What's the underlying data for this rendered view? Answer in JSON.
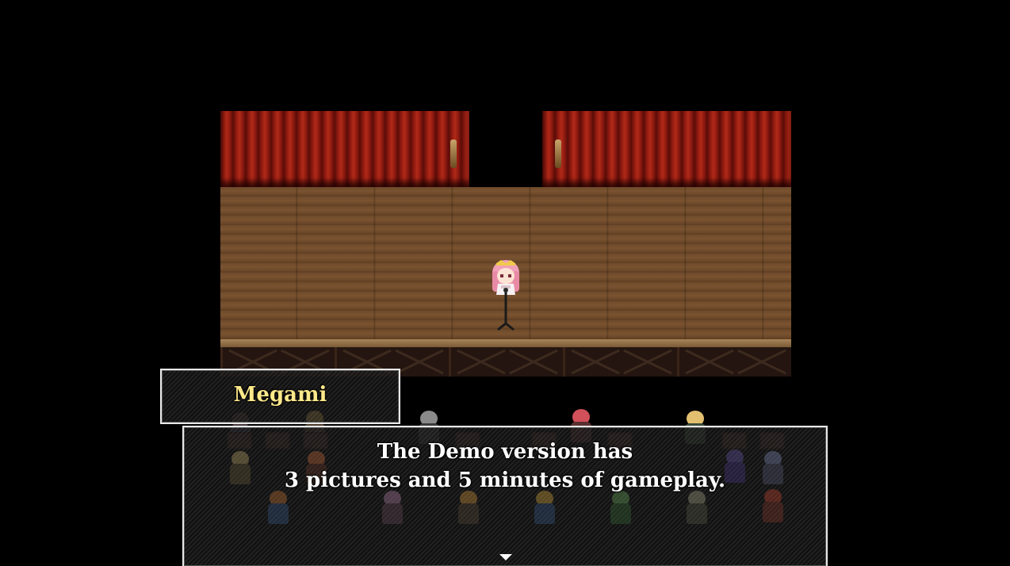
{
  "dialogue": {
    "speaker": "Megami",
    "lines": [
      "The Demo version has",
      "3 pictures and 5 minutes of gameplay."
    ]
  },
  "colors": {
    "background": "#000000",
    "speaker_name": "#ffe98a",
    "message_text": "#ffffff",
    "curtain": "#8e1a10",
    "stage_floor": "#6e4a2a"
  },
  "icons": {
    "continue": "continue-arrow-icon"
  }
}
